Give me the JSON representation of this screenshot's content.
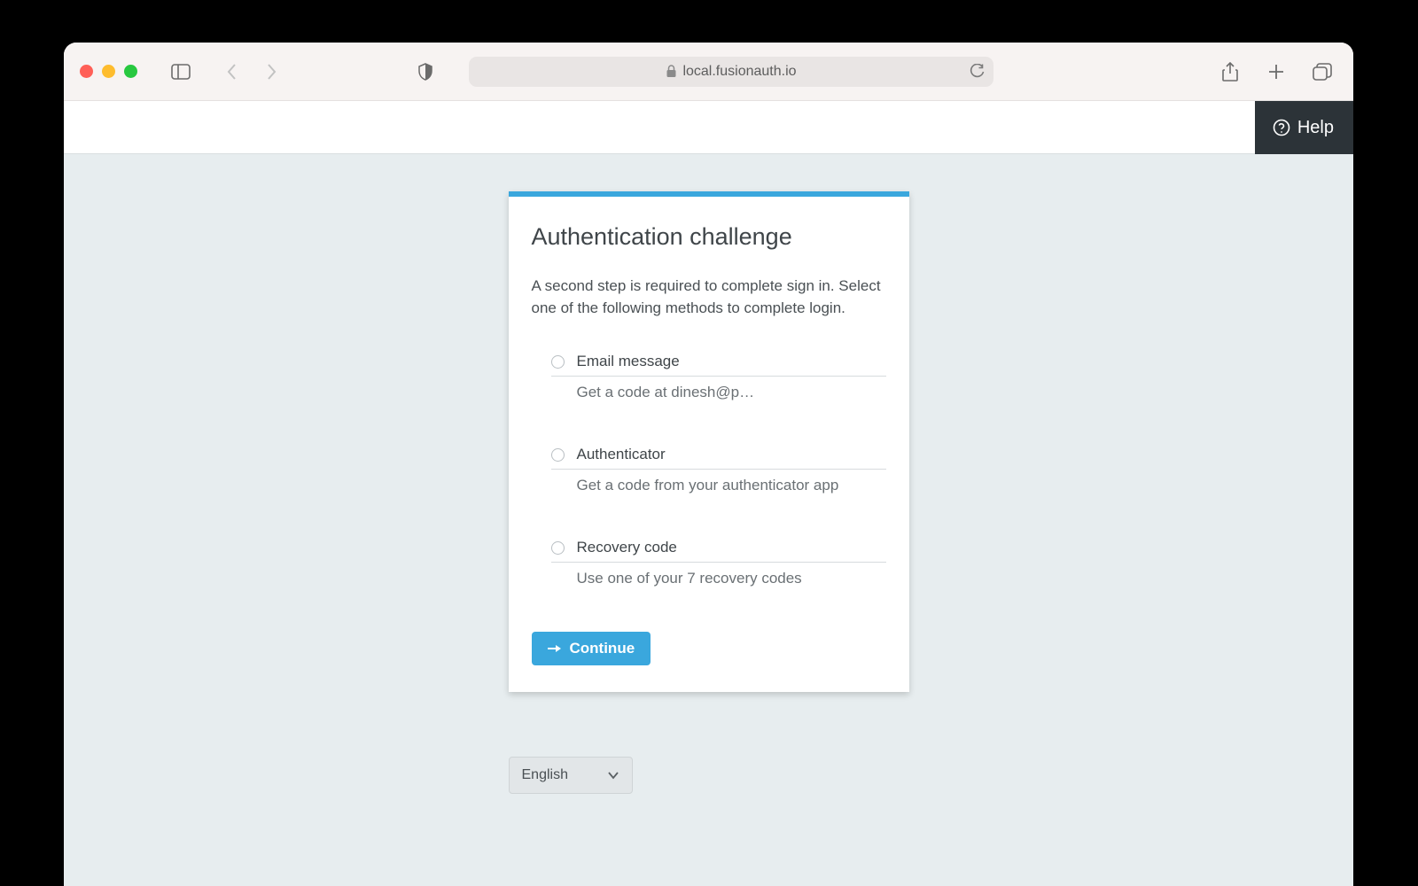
{
  "browser": {
    "url_display": "local.fusionauth.io"
  },
  "topbar": {
    "help_label": "Help"
  },
  "card": {
    "title": "Authentication challenge",
    "intro": "A second step is required to complete sign in. Select one of the following methods to complete login.",
    "methods": [
      {
        "title": "Email message",
        "sub": "Get a code at dinesh@p…"
      },
      {
        "title": " Authenticator",
        "sub": "Get a code from your authenticator app"
      },
      {
        "title": "Recovery code",
        "sub": "Use one of your 7 recovery codes"
      }
    ],
    "continue_label": "Continue"
  },
  "language": {
    "selected": "English"
  }
}
